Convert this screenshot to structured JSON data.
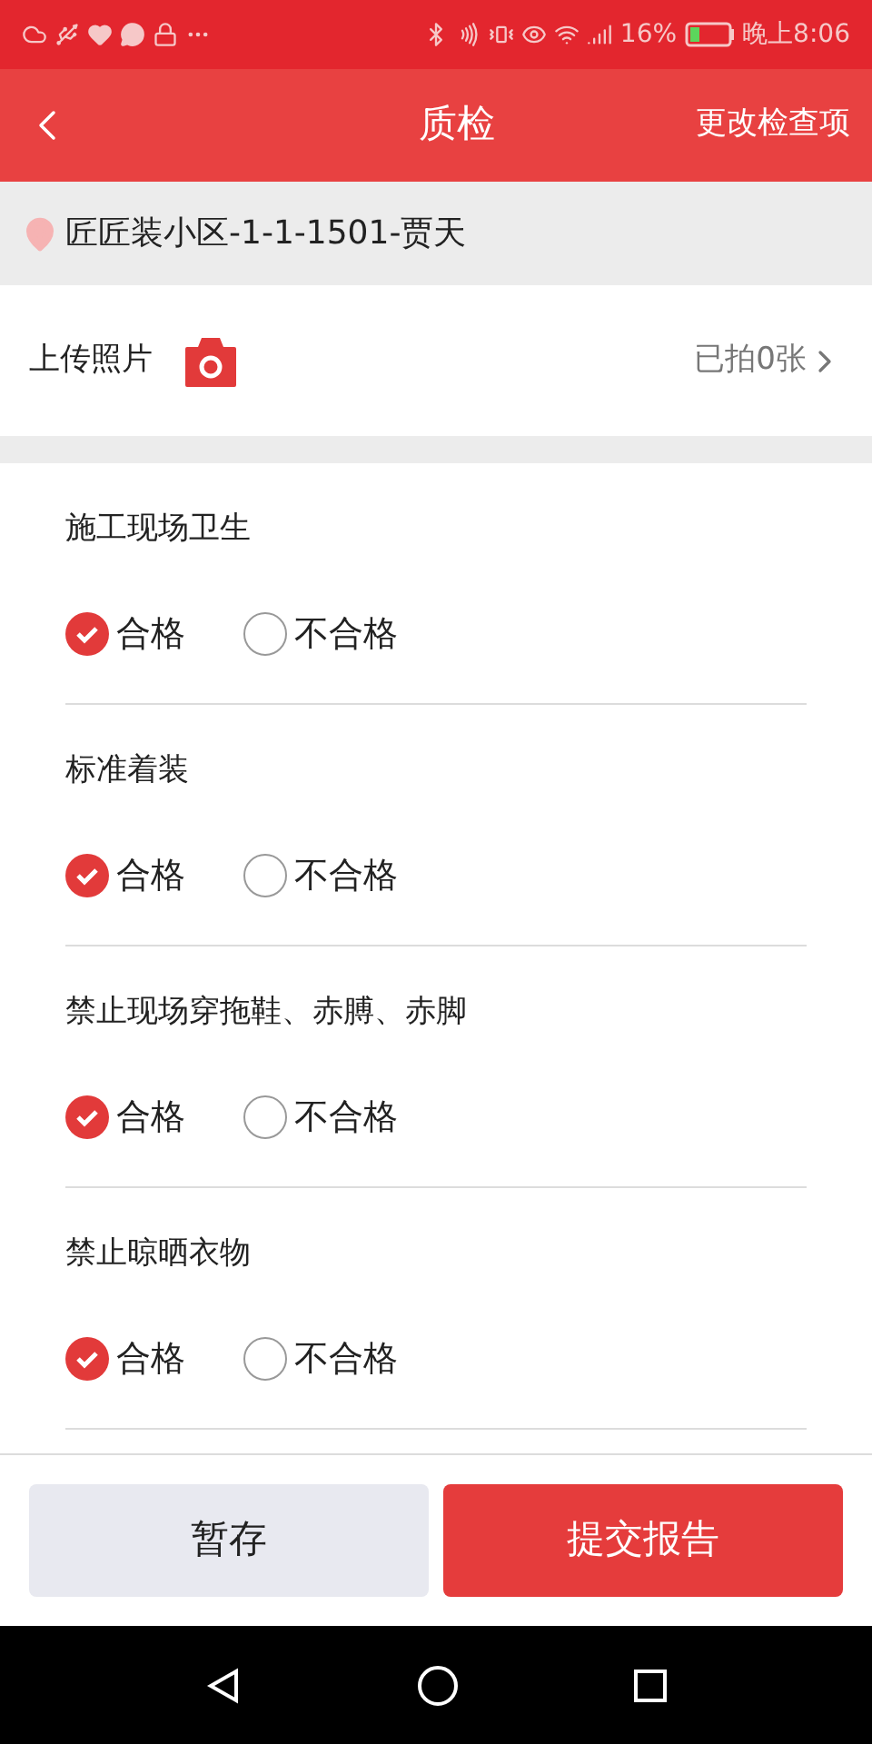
{
  "status_bar": {
    "battery": "16%",
    "time": "晚上8:06"
  },
  "header": {
    "title": "质检",
    "action": "更改检查项"
  },
  "address": "匠匠装小区-1-1-1501-贾天",
  "photos": {
    "label": "上传照片",
    "count": "已拍0张"
  },
  "items": [
    {
      "title": "施工现场卫生",
      "options": [
        {
          "label": "合格",
          "selected": true
        },
        {
          "label": "不合格",
          "selected": false
        }
      ]
    },
    {
      "title": "标准着装",
      "options": [
        {
          "label": "合格",
          "selected": true
        },
        {
          "label": "不合格",
          "selected": false
        }
      ]
    },
    {
      "title": "禁止现场穿拖鞋、赤膊、赤脚",
      "options": [
        {
          "label": "合格",
          "selected": true
        },
        {
          "label": "不合格",
          "selected": false
        }
      ]
    },
    {
      "title": "禁止晾晒衣物",
      "options": [
        {
          "label": "合格",
          "selected": true
        },
        {
          "label": "不合格",
          "selected": false
        }
      ]
    }
  ],
  "buttons": {
    "save": "暂存",
    "submit": "提交报告"
  }
}
